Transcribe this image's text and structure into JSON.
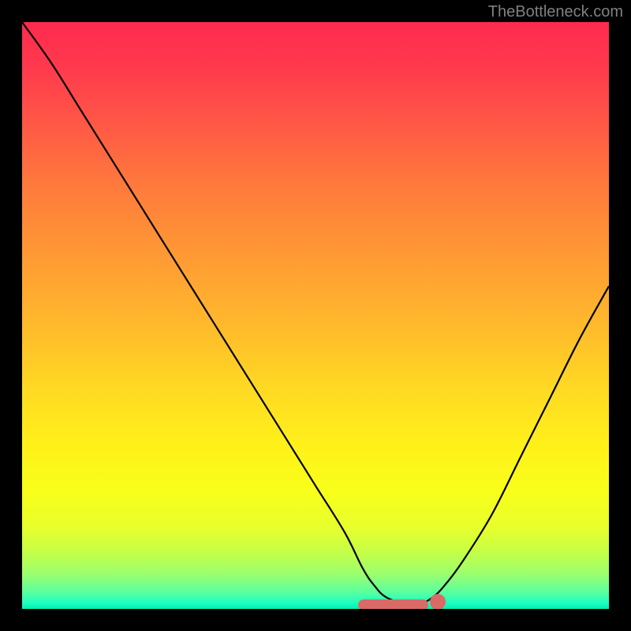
{
  "watermark": "TheBottleneck.com",
  "chart_data": {
    "type": "line",
    "title": "",
    "xlabel": "",
    "ylabel": "",
    "xlim": [
      0,
      100
    ],
    "ylim": [
      0,
      100
    ],
    "x": [
      0,
      5,
      10,
      15,
      20,
      25,
      30,
      35,
      40,
      45,
      50,
      55,
      58,
      60,
      62,
      65,
      68,
      70,
      72,
      75,
      80,
      85,
      90,
      95,
      100
    ],
    "values": [
      100,
      93,
      85,
      77,
      69,
      61,
      53,
      45,
      37,
      29,
      21,
      13,
      7,
      4,
      2,
      1,
      1,
      2,
      4,
      8,
      16,
      26,
      36,
      46,
      55
    ],
    "series": [
      {
        "name": "bottleneck-curve",
        "x_ref": "x",
        "y_ref": "values"
      }
    ],
    "optimal_range": {
      "x_start": 58,
      "x_end": 70,
      "y": 0
    },
    "background_gradient": {
      "direction": "vertical",
      "stops": [
        {
          "pos": 0,
          "color": "#ff2a4f"
        },
        {
          "pos": 0.5,
          "color": "#ffba2c"
        },
        {
          "pos": 0.8,
          "color": "#f8ff1a"
        },
        {
          "pos": 1.0,
          "color": "#00f0b0"
        }
      ]
    }
  }
}
